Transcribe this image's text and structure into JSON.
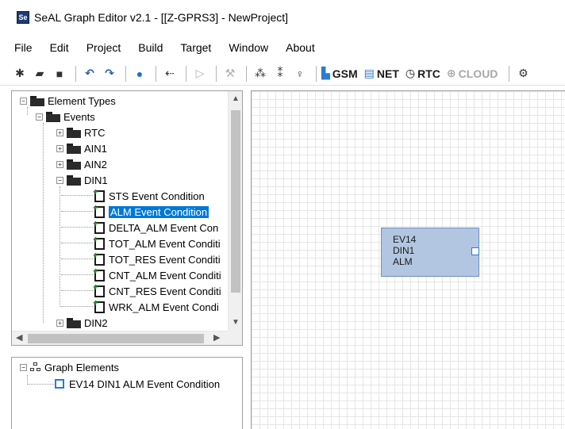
{
  "window": {
    "app_icon_text": "Se",
    "title": "SeAL Graph Editor v2.1 - [[Z-GPRS3] - NewProject]"
  },
  "menu": [
    "File",
    "Edit",
    "Project",
    "Build",
    "Target",
    "Window",
    "About"
  ],
  "toolbar": {
    "gsm_label": "GSM",
    "net_label": "NET",
    "rtc_label": "RTC",
    "cloud_label": "CLOUD"
  },
  "tree": {
    "root": "Element Types",
    "events": "Events",
    "rtc": "RTC",
    "ain1": "AIN1",
    "ain2": "AIN2",
    "din1": "DIN1",
    "din1_children": [
      "STS Event Condition",
      "ALM Event Condition",
      "DELTA_ALM Event Con",
      "TOT_ALM Event Conditi",
      "TOT_RES Event Conditi",
      "CNT_ALM Event Conditi",
      "CNT_RES Event Conditi",
      "WRK_ALM Event Condi"
    ],
    "din2": "DIN2",
    "selected_index": 1
  },
  "graph_elements": {
    "root": "Graph Elements",
    "items": [
      "EV14 DIN1 ALM Event Condition"
    ]
  },
  "canvas": {
    "node": {
      "lines": [
        "EV14",
        "DIN1",
        "ALM"
      ]
    }
  },
  "colors": {
    "selection": "#0078d7",
    "node_fill": "#b3c6e1",
    "node_border": "#6c8fc4",
    "grid": "#e6e6e6"
  }
}
